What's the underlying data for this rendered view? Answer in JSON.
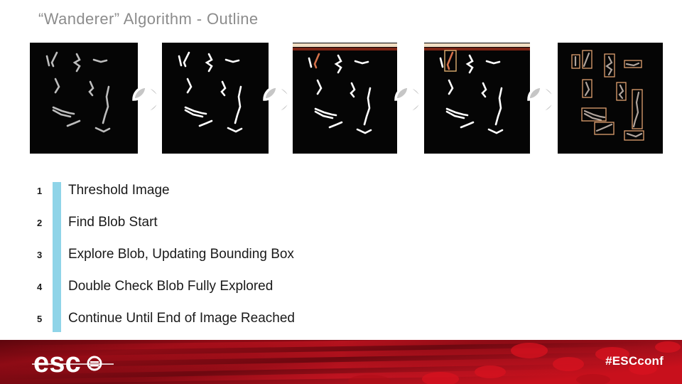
{
  "slide": {
    "title": "“Wanderer”  Algorithm - Outline",
    "background": "#ffffff"
  },
  "figure": {
    "panel_count": 5,
    "panel_background": "#050505",
    "connector_color": "#c6c6c6",
    "connector_outline": "#ffffff",
    "panels": [
      {
        "id": "panel-original",
        "caption_role": "original grayscale image",
        "blob_color": "#bdbdbd",
        "has_scanline": false,
        "has_single_box": false,
        "has_all_boxes": false
      },
      {
        "id": "panel-threshold",
        "caption_role": "thresholded binary image",
        "blob_color": "#ffffff",
        "has_scanline": false,
        "has_single_box": false,
        "has_all_boxes": false
      },
      {
        "id": "panel-scan",
        "caption_role": "scanning for blob start",
        "blob_color": "#ffffff",
        "has_scanline": true,
        "has_single_box": false,
        "has_all_boxes": false
      },
      {
        "id": "panel-explore",
        "caption_role": "blob explored with bounding box",
        "blob_color": "#ffffff",
        "has_scanline": true,
        "has_single_box": true,
        "has_all_boxes": false
      },
      {
        "id": "panel-complete",
        "caption_role": "all blobs bounded",
        "blob_color": "#b0a49c",
        "has_scanline": false,
        "has_single_box": false,
        "has_all_boxes": true
      }
    ],
    "scanline_colors": {
      "top": "#f2dfc4",
      "bottom": "#7d2414"
    },
    "bounding_box_color": "#e0a070",
    "highlight_blob_color": "#d4714a"
  },
  "outline": {
    "accent_bar_color": "#8fd4e8",
    "steps": [
      {
        "number": "1",
        "label": "Threshold Image"
      },
      {
        "number": "2",
        "label": "Find Blob Start"
      },
      {
        "number": "3",
        "label": "Explore Blob, Updating Bounding Box"
      },
      {
        "number": "4",
        "label": "Double Check Blob Fully Explored"
      },
      {
        "number": "5",
        "label": "Continue Until End of Image Reached"
      }
    ]
  },
  "footer": {
    "logo_text": "esc",
    "hashtag": "#ESCconf",
    "background_color": "#8a0a13",
    "accent_color": "#c8101c",
    "text_color": "#ffffff"
  }
}
